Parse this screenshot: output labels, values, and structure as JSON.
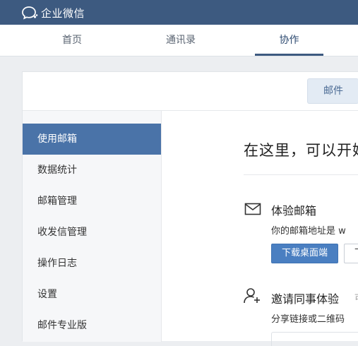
{
  "app": {
    "title": "企业微信"
  },
  "nav": {
    "tabs": [
      {
        "label": "首页"
      },
      {
        "label": "通讯录"
      },
      {
        "label": "协作"
      }
    ]
  },
  "header": {
    "mail_button": "邮件"
  },
  "sidebar": {
    "items": [
      {
        "label": "使用邮箱"
      },
      {
        "label": "数据统计"
      },
      {
        "label": "邮箱管理"
      },
      {
        "label": "收发信管理"
      },
      {
        "label": "操作日志"
      },
      {
        "label": "设置"
      },
      {
        "label": "邮件专业版"
      }
    ]
  },
  "main": {
    "title": "在这里，可以开始",
    "experience": {
      "title": "体验邮箱",
      "desc": "你的邮箱地址是 w",
      "download_desktop": "下载桌面端",
      "download_more": "下"
    },
    "invite": {
      "title": "邀请同事体验",
      "badge": "可",
      "desc": "分享链接或二维码"
    }
  },
  "colors": {
    "topbar": "#3d5a80",
    "accent": "#4a73a8",
    "primary_button": "#4a7fc1"
  }
}
